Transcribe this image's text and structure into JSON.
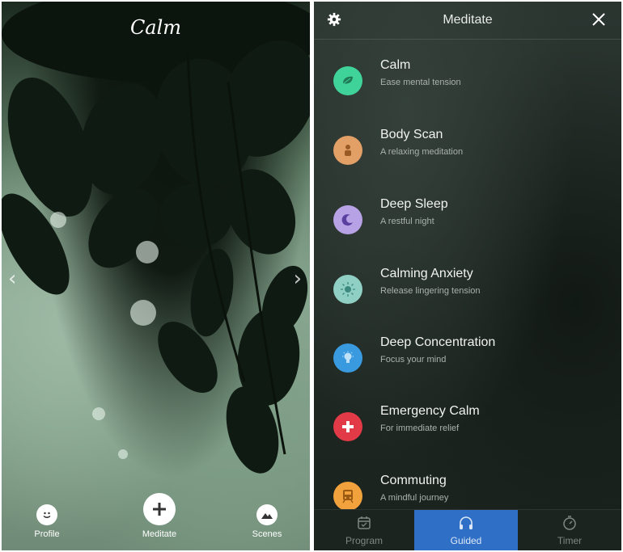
{
  "left_panel": {
    "logo": "Calm",
    "nav_prev": "‹",
    "nav_next": "›",
    "bottom_nav": [
      {
        "label": "Profile",
        "icon": "smiley-icon"
      },
      {
        "label": "Meditate",
        "icon": "plus-icon"
      },
      {
        "label": "Scenes",
        "icon": "mountain-icon"
      }
    ]
  },
  "right_panel": {
    "header": {
      "title": "Meditate",
      "settings_icon": "gear-icon",
      "close_icon": "close-icon"
    },
    "sessions": [
      {
        "name": "Calm",
        "description": "Ease mental tension",
        "color": "#3fd39a",
        "icon": "leaf-icon"
      },
      {
        "name": "Body Scan",
        "description": "A relaxing meditation",
        "color": "#e2a066",
        "icon": "person-icon"
      },
      {
        "name": "Deep Sleep",
        "description": "A restful night",
        "color": "#b8a2e6",
        "icon": "moon-icon"
      },
      {
        "name": "Calming Anxiety",
        "description": "Release lingering tension",
        "color": "#8fcfc4",
        "icon": "sun-icon"
      },
      {
        "name": "Deep Concentration",
        "description": "Focus your mind",
        "color": "#3a9ae0",
        "icon": "bulb-icon"
      },
      {
        "name": "Emergency Calm",
        "description": "For immediate relief",
        "color": "#e23a46",
        "icon": "cross-icon"
      },
      {
        "name": "Commuting",
        "description": "A mindful journey",
        "color": "#f2a23c",
        "icon": "train-icon"
      }
    ],
    "tabs": [
      {
        "label": "Program",
        "icon": "calendar-icon"
      },
      {
        "label": "Guided",
        "icon": "headphones-icon",
        "active": true
      },
      {
        "label": "Timer",
        "icon": "stopwatch-icon"
      }
    ]
  }
}
